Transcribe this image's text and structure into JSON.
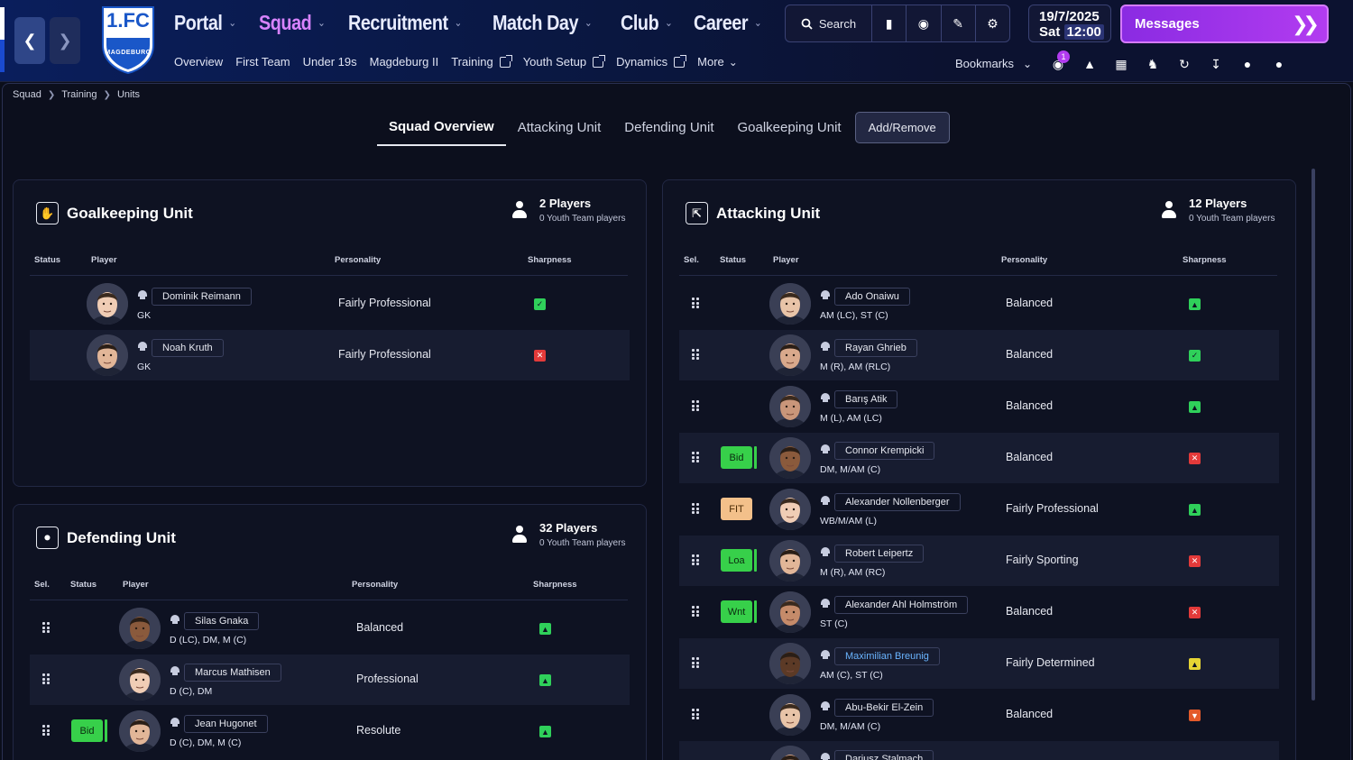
{
  "header": {
    "nav": [
      {
        "label": "Portal",
        "caret": true,
        "active": false
      },
      {
        "label": "Squad",
        "caret": true,
        "active": true
      },
      {
        "label": "Recruitment",
        "caret": true,
        "active": false
      },
      {
        "label": "Match Day",
        "caret": true,
        "active": false
      },
      {
        "label": "Club",
        "caret": true,
        "active": false
      },
      {
        "label": "Career",
        "caret": true,
        "active": false
      }
    ],
    "subnav": [
      {
        "label": "Overview",
        "external": false
      },
      {
        "label": "First Team",
        "external": false
      },
      {
        "label": "Under 19s",
        "external": false
      },
      {
        "label": "Magdeburg II",
        "external": false
      },
      {
        "label": "Training",
        "external": true
      },
      {
        "label": "Youth Setup",
        "external": true
      },
      {
        "label": "Dynamics",
        "external": true
      },
      {
        "label": "More",
        "external": false
      }
    ],
    "crest": {
      "line1": "1.FC",
      "line2": "MAGDEBURG"
    },
    "search_label": "Search",
    "date": "19/7/2025",
    "day": "Sat",
    "time": "12:00",
    "messages_label": "Messages",
    "bookmarks_label": "Bookmarks",
    "notification_count": "1"
  },
  "breadcrumb": [
    "Squad",
    "Training",
    "Units"
  ],
  "tabs": [
    "Squad Overview",
    "Attacking Unit",
    "Defending Unit",
    "Goalkeeping Unit",
    "Add/Remove"
  ],
  "goalkeeping": {
    "title": "Goalkeeping Unit",
    "count": "2 Players",
    "youth": "0 Youth Team players",
    "columns": [
      "Status",
      "Player",
      "Personality",
      "Sharpness"
    ],
    "players": [
      {
        "name": "Dominik Reimann",
        "pos": "GK",
        "personality": "Fairly Professional",
        "sharp": "ok"
      },
      {
        "name": "Noah Kruth",
        "pos": "GK",
        "personality": "Fairly Professional",
        "sharp": "bad"
      }
    ]
  },
  "defending": {
    "title": "Defending Unit",
    "count": "32 Players",
    "youth": "0 Youth Team players",
    "columns": [
      "Sel.",
      "Status",
      "Player",
      "Personality",
      "Sharpness"
    ],
    "players": [
      {
        "name": "Silas Gnaka",
        "pos": "D (LC), DM, M (C)",
        "personality": "Balanced",
        "sharp": "up",
        "status": ""
      },
      {
        "name": "Marcus Mathisen",
        "pos": "D (C), DM",
        "personality": "Professional",
        "sharp": "up",
        "status": ""
      },
      {
        "name": "Jean Hugonet",
        "pos": "D (C), DM, M (C)",
        "personality": "Resolute",
        "sharp": "up",
        "status": "Bid"
      }
    ]
  },
  "attacking": {
    "title": "Attacking Unit",
    "count": "12 Players",
    "youth": "0 Youth Team players",
    "columns": [
      "Sel.",
      "Status",
      "Player",
      "Personality",
      "Sharpness"
    ],
    "players": [
      {
        "name": "Ado Onaiwu",
        "pos": "AM (LC), ST (C)",
        "personality": "Balanced",
        "sharp": "up",
        "status": ""
      },
      {
        "name": "Rayan Ghrieb",
        "pos": "M (R), AM (RLC)",
        "personality": "Balanced",
        "sharp": "ok",
        "status": ""
      },
      {
        "name": "Barış Atik",
        "pos": "M (L), AM (LC)",
        "personality": "Balanced",
        "sharp": "up",
        "status": ""
      },
      {
        "name": "Connor Krempicki",
        "pos": "DM, M/AM (C)",
        "personality": "Balanced",
        "sharp": "bad",
        "status": "Bid"
      },
      {
        "name": "Alexander Nollenberger",
        "pos": "WB/M/AM (L)",
        "personality": "Fairly Professional",
        "sharp": "up",
        "status": "FIT"
      },
      {
        "name": "Robert Leipertz",
        "pos": "M (R), AM (RC)",
        "personality": "Fairly Sporting",
        "sharp": "bad",
        "status": "Loa"
      },
      {
        "name": "Alexander Ahl Holmström",
        "pos": "ST (C)",
        "personality": "Balanced",
        "sharp": "bad",
        "status": "Wnt"
      },
      {
        "name": "Maximilian Breunig",
        "pos": "AM (C), ST (C)",
        "personality": "Fairly Determined",
        "sharp": "yel",
        "status": "",
        "highlight": true
      },
      {
        "name": "Abu-Bekir El-Zein",
        "pos": "DM, M/AM (C)",
        "personality": "Balanced",
        "sharp": "dn",
        "status": ""
      },
      {
        "name": "Dariusz Stalmach",
        "pos": "",
        "personality": "",
        "sharp": "",
        "status": ""
      }
    ]
  },
  "colors": {
    "accent": "#b23cf0",
    "active_nav": "#d883ff",
    "ok": "#2fd05a",
    "bad": "#e33a3a"
  }
}
